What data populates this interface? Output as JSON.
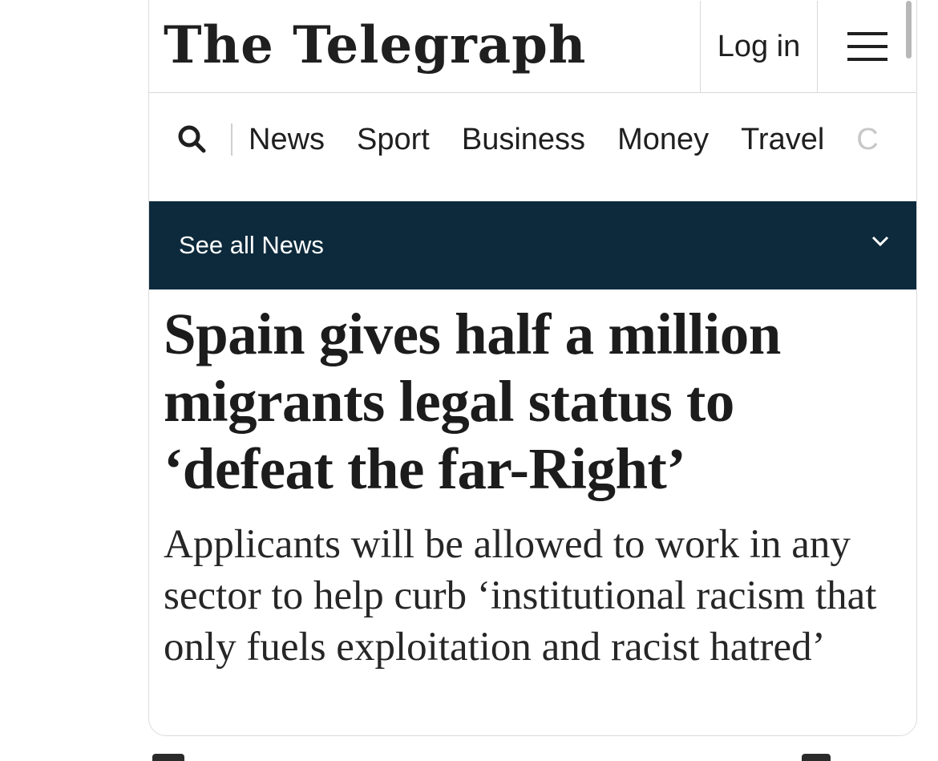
{
  "header": {
    "logo": "The Telegraph",
    "login_label": "Log in",
    "menu_icon": "hamburger-menu-icon"
  },
  "nav": {
    "search_icon": "search-icon",
    "items": [
      "News",
      "Sport",
      "Business",
      "Money",
      "Travel",
      "C"
    ]
  },
  "banner": {
    "label": "See all News",
    "chevron_icon": "chevron-down-icon",
    "background": "#0d2a3c"
  },
  "article": {
    "headline": "Spain gives half a million migrants legal status to ‘defeat the far-Right’",
    "standfirst": "Applicants will be allowed to work in any sector to help curb ‘institutional racism that only fuels exploitation and racist hatred’"
  }
}
